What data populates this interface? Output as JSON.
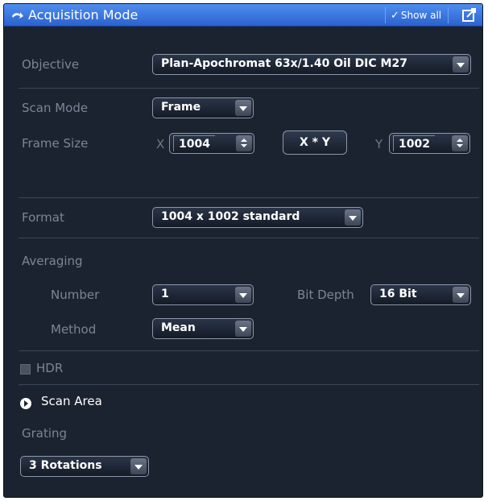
{
  "titlebar": {
    "title": "Acquisition Mode",
    "show_all": "Show all",
    "colors": {
      "accent": "#2a62cf"
    }
  },
  "objective": {
    "label": "Objective",
    "value": "Plan-Apochromat 63x/1.40 Oil DIC M27"
  },
  "scan_mode": {
    "label": "Scan Mode",
    "value": "Frame"
  },
  "frame_size": {
    "label": "Frame Size",
    "x_label": "X",
    "x_value": "1004",
    "xy_button": "X * Y",
    "y_label": "Y",
    "y_value": "1002"
  },
  "format": {
    "label": "Format",
    "value": "1004 x 1002 standard"
  },
  "averaging": {
    "label": "Averaging",
    "number_label": "Number",
    "number_value": "1",
    "bit_depth_label": "Bit Depth",
    "bit_depth_value": "16 Bit",
    "method_label": "Method",
    "method_value": "Mean"
  },
  "hdr": {
    "label": "HDR",
    "checked": false
  },
  "scan_area": {
    "label": "Scan Area"
  },
  "grating": {
    "label": "Grating",
    "value": "3 Rotations"
  },
  "icons": [
    "collapse-arrow-icon",
    "checkmark-icon",
    "detach-window-icon",
    "dropdown-arrow-icon",
    "spin-up-icon",
    "spin-down-icon",
    "expander-icon"
  ]
}
